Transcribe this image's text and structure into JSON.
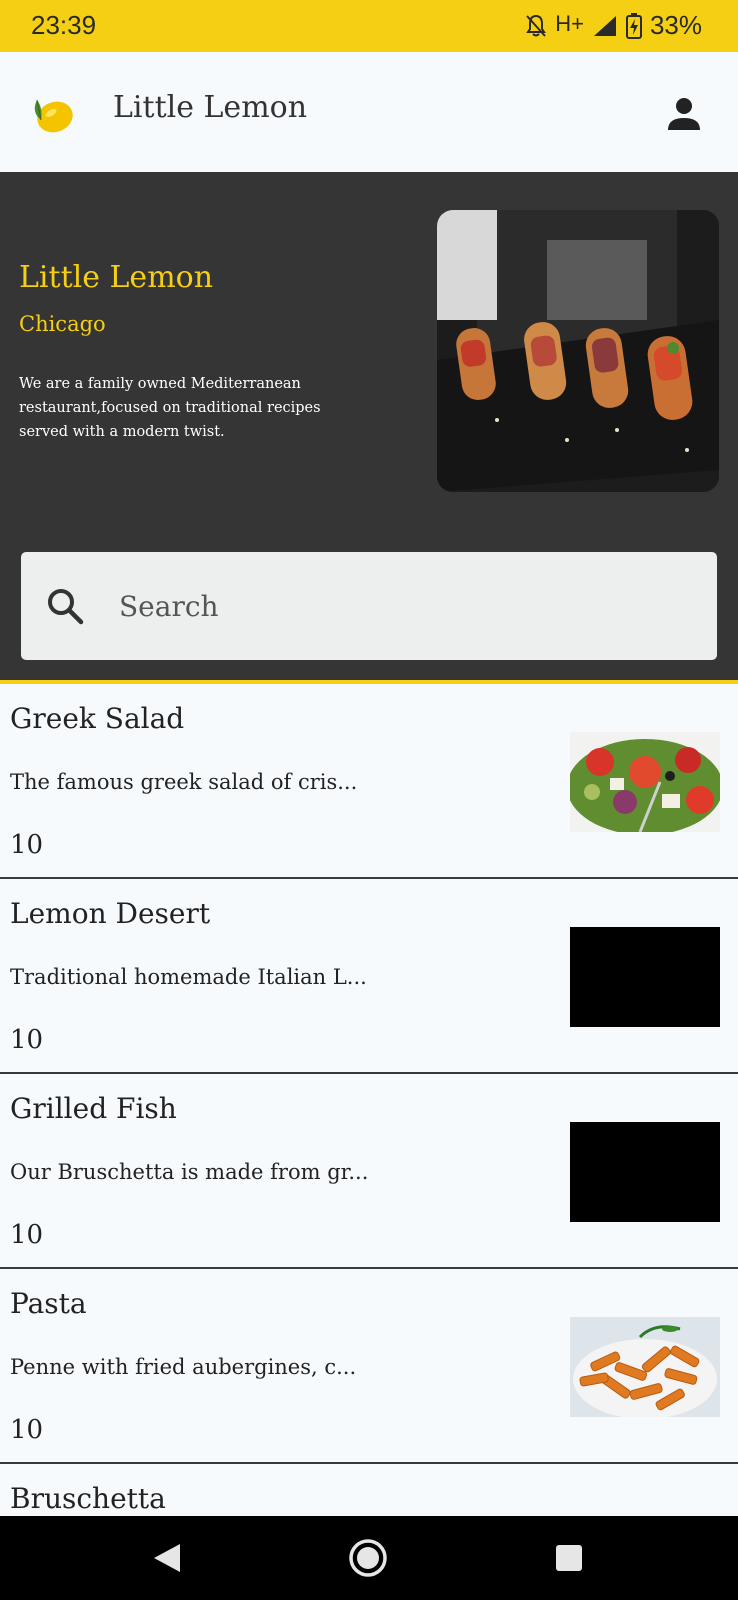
{
  "status_bar": {
    "time": "23:39",
    "network": "H+",
    "battery": "33%"
  },
  "app": {
    "title": "Little Lemon",
    "logo_icon": "lemon-icon",
    "profile_icon": "person-icon"
  },
  "hero": {
    "title": "Little Lemon",
    "city": "Chicago",
    "description": "We are a family owned Mediterranean restaurant,focused on traditional recipes served with a modern twist.",
    "image": "bruschetta-platter-photo"
  },
  "search": {
    "placeholder": "Search",
    "value": "",
    "icon": "search-icon"
  },
  "menu": [
    {
      "name": "Greek Salad",
      "description": "The famous greek salad of cris...",
      "price": "10",
      "image": "greek-salad-photo"
    },
    {
      "name": "Lemon Desert",
      "description": "Traditional homemade Italian L...",
      "price": "10",
      "image": "black-placeholder"
    },
    {
      "name": "Grilled Fish",
      "description": "Our Bruschetta is made from gr...",
      "price": "10",
      "image": "black-placeholder"
    },
    {
      "name": "Pasta",
      "description": "Penne with fried aubergines, c...",
      "price": "10",
      "image": "penne-pasta-photo"
    },
    {
      "name": "Bruschetta",
      "description": "",
      "price": "",
      "image": ""
    }
  ],
  "colors": {
    "accent": "#f5cf14",
    "hero_bg": "#353535",
    "page_bg": "#f7fafd",
    "search_bg": "#edeeee"
  },
  "nav_bar": {
    "icons": [
      "back-icon",
      "home-icon",
      "recents-icon"
    ]
  }
}
